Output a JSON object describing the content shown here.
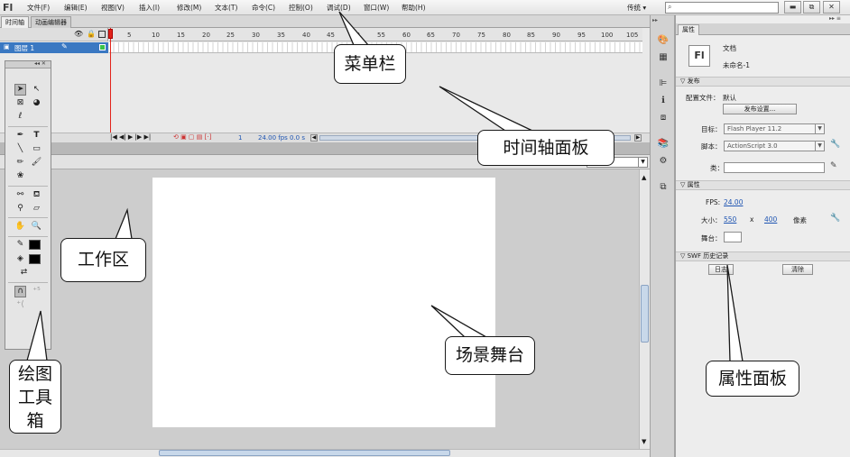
{
  "app": {
    "logo": "Fl"
  },
  "menubar": {
    "items": [
      "文件(F)",
      "编辑(E)",
      "视图(V)",
      "插入(I)",
      "修改(M)",
      "文本(T)",
      "命令(C)",
      "控制(O)",
      "调试(D)",
      "窗口(W)",
      "帮助(H)"
    ],
    "workspace": "传统 ▾",
    "search_icon": "search-icon",
    "window_buttons": [
      "▬",
      "⧉",
      "✕"
    ]
  },
  "timeline": {
    "tabs": [
      "时间轴",
      "动画编辑器"
    ],
    "layer_name": "图层 1",
    "ruler_ticks": [
      "5",
      "10",
      "15",
      "20",
      "25",
      "30",
      "35",
      "40",
      "45",
      "50",
      "55",
      "60",
      "65",
      "70",
      "75",
      "80",
      "85",
      "90",
      "95",
      "100",
      "105"
    ],
    "current_frame": "1",
    "fps": "24.00 fps",
    "time": "0.0 s"
  },
  "properties": {
    "tab": "属性",
    "doc_icon": "Fl",
    "doc_type": "文档",
    "doc_name": "未命名-1",
    "publish": {
      "header": "发布",
      "profile_label": "配置文件：",
      "profile_value": "默认",
      "settings_button": "发布设置..."
    },
    "target_label": "目标：",
    "target_value": "Flash Player 11.2",
    "script_label": "脚本：",
    "script_value": "ActionScript 3.0",
    "class_label": "类：",
    "props_header": "属性",
    "fps_label": "FPS:",
    "fps_value": "24.00",
    "size_label": "大小：",
    "width_value": "550",
    "times": "x",
    "height_value": "400",
    "unit": "像素",
    "stage_label": "舞台：",
    "stage_color": "#ffffff",
    "swf_header": "SWF 历史记录",
    "log_button": "日志",
    "clear_button": "清除"
  },
  "callouts": {
    "menubar": "菜单栏",
    "timeline": "时间轴面板",
    "workarea": "工作区",
    "stage": "场景舞台",
    "tools": [
      "绘图",
      "工具",
      "箱"
    ],
    "properties": "属性面板"
  },
  "colors": {
    "playhead": "#e2231a",
    "layer_selected": "#3a78c2",
    "link_blue": "#1f55b2"
  }
}
